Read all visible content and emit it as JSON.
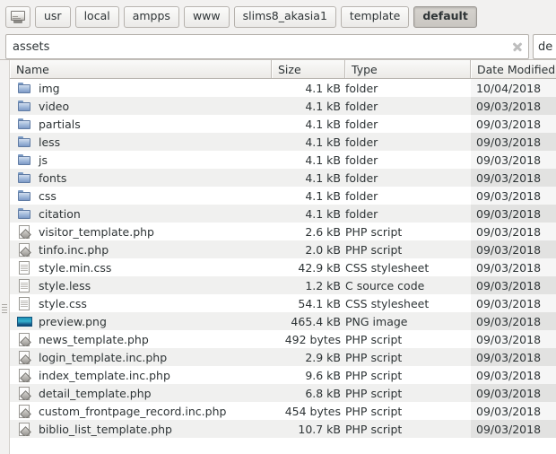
{
  "pathbar": {
    "home_icon": "computer-icon",
    "crumbs": [
      {
        "label": "usr",
        "active": false
      },
      {
        "label": "local",
        "active": false
      },
      {
        "label": "ampps",
        "active": false
      },
      {
        "label": "www",
        "active": false
      },
      {
        "label": "slims8_akasia1",
        "active": false
      },
      {
        "label": "template",
        "active": false
      },
      {
        "label": "default",
        "active": true
      }
    ]
  },
  "location": {
    "value": "assets",
    "clear_icon": "clear-x-icon",
    "secondary_value": "de"
  },
  "columns": {
    "name": "Name",
    "size": "Size",
    "type": "Type",
    "date": "Date Modified"
  },
  "files": [
    {
      "icon": "folder-icon",
      "kind": "folder",
      "name": "img",
      "size": "4.1 kB",
      "type": "folder",
      "date": "10/04/2018"
    },
    {
      "icon": "folder-icon",
      "kind": "folder",
      "name": "video",
      "size": "4.1 kB",
      "type": "folder",
      "date": "09/03/2018"
    },
    {
      "icon": "folder-icon",
      "kind": "folder",
      "name": "partials",
      "size": "4.1 kB",
      "type": "folder",
      "date": "09/03/2018"
    },
    {
      "icon": "folder-icon",
      "kind": "folder",
      "name": "less",
      "size": "4.1 kB",
      "type": "folder",
      "date": "09/03/2018"
    },
    {
      "icon": "folder-icon",
      "kind": "folder",
      "name": "js",
      "size": "4.1 kB",
      "type": "folder",
      "date": "09/03/2018"
    },
    {
      "icon": "folder-icon",
      "kind": "folder",
      "name": "fonts",
      "size": "4.1 kB",
      "type": "folder",
      "date": "09/03/2018"
    },
    {
      "icon": "folder-icon",
      "kind": "folder",
      "name": "css",
      "size": "4.1 kB",
      "type": "folder",
      "date": "09/03/2018"
    },
    {
      "icon": "folder-icon",
      "kind": "folder",
      "name": "citation",
      "size": "4.1 kB",
      "type": "folder",
      "date": "09/03/2018"
    },
    {
      "icon": "php-file-icon",
      "kind": "php",
      "name": "visitor_template.php",
      "size": "2.6 kB",
      "type": "PHP script",
      "date": "09/03/2018"
    },
    {
      "icon": "php-file-icon",
      "kind": "php",
      "name": "tinfo.inc.php",
      "size": "2.0 kB",
      "type": "PHP script",
      "date": "09/03/2018"
    },
    {
      "icon": "text-file-icon",
      "kind": "doc",
      "name": "style.min.css",
      "size": "42.9 kB",
      "type": "CSS stylesheet",
      "date": "09/03/2018"
    },
    {
      "icon": "text-file-icon",
      "kind": "doc",
      "name": "style.less",
      "size": "1.2 kB",
      "type": "C source code",
      "date": "09/03/2018"
    },
    {
      "icon": "text-file-icon",
      "kind": "doc",
      "name": "style.css",
      "size": "54.1 kB",
      "type": "CSS stylesheet",
      "date": "09/03/2018"
    },
    {
      "icon": "image-file-icon",
      "kind": "img",
      "name": "preview.png",
      "size": "465.4 kB",
      "type": "PNG image",
      "date": "09/03/2018"
    },
    {
      "icon": "php-file-icon",
      "kind": "php",
      "name": "news_template.php",
      "size": "492 bytes",
      "type": "PHP script",
      "date": "09/03/2018"
    },
    {
      "icon": "php-file-icon",
      "kind": "php",
      "name": "login_template.inc.php",
      "size": "2.9 kB",
      "type": "PHP script",
      "date": "09/03/2018"
    },
    {
      "icon": "php-file-icon",
      "kind": "php",
      "name": "index_template.inc.php",
      "size": "9.6 kB",
      "type": "PHP script",
      "date": "09/03/2018"
    },
    {
      "icon": "php-file-icon",
      "kind": "php",
      "name": "detail_template.php",
      "size": "6.8 kB",
      "type": "PHP script",
      "date": "09/03/2018"
    },
    {
      "icon": "php-file-icon",
      "kind": "php",
      "name": "custom_frontpage_record.inc.php",
      "size": "454 bytes",
      "type": "PHP script",
      "date": "09/03/2018"
    },
    {
      "icon": "php-file-icon",
      "kind": "php",
      "name": "biblio_list_template.php",
      "size": "10.7 kB",
      "type": "PHP script",
      "date": "09/03/2018"
    }
  ]
}
